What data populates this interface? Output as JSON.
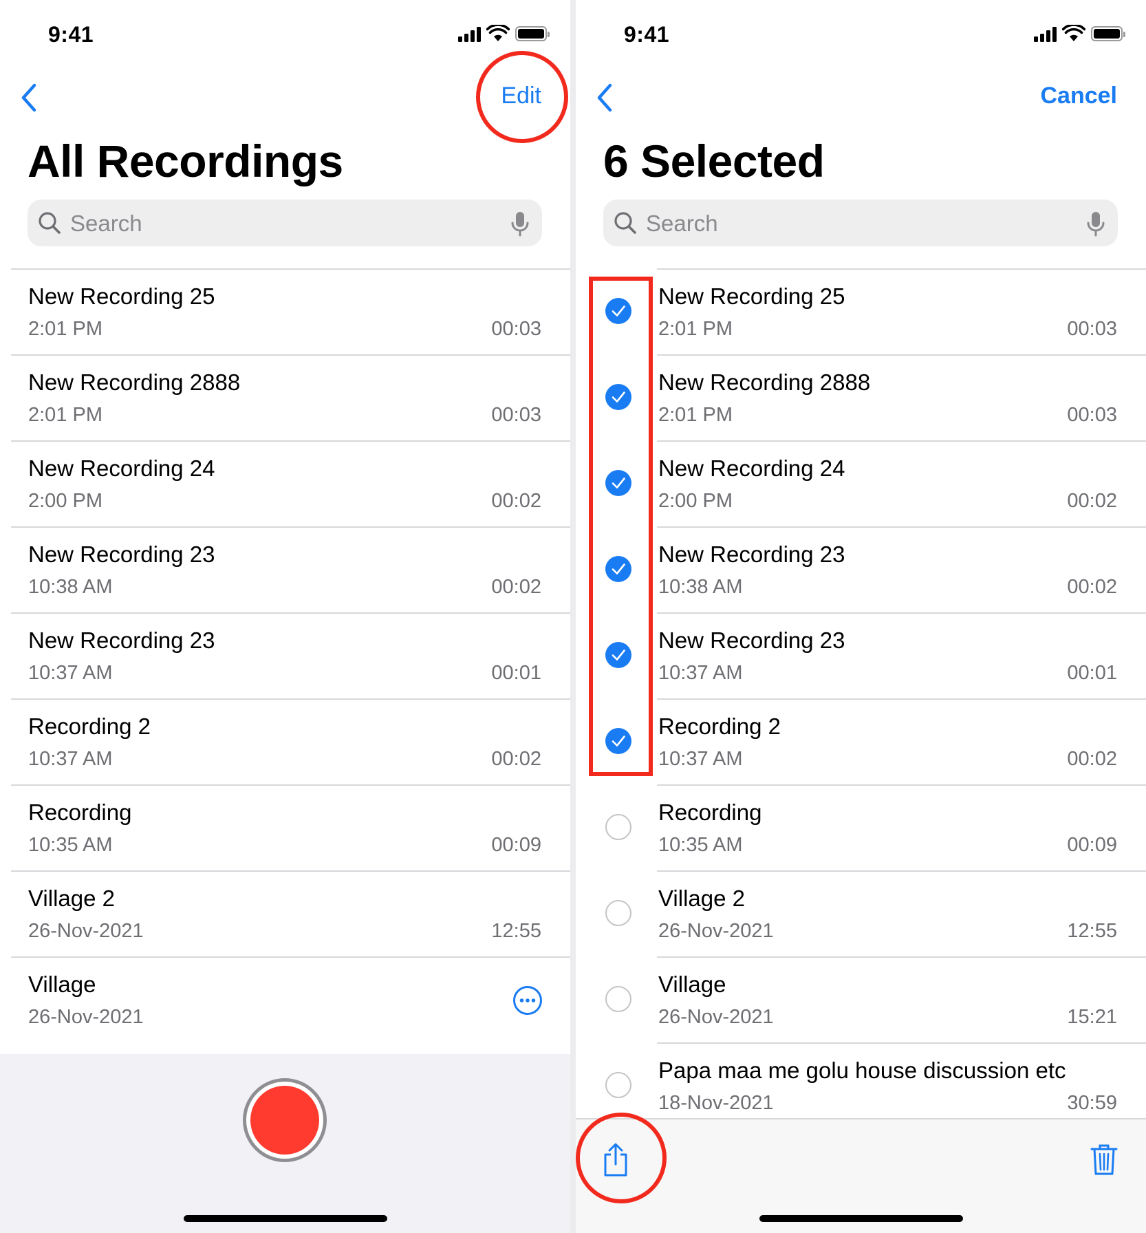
{
  "colors": {
    "accent": "#1a7cf2",
    "record": "#ff3b30",
    "annotation": "#f22a1d",
    "secondary_text": "#6e6e73"
  },
  "left": {
    "status": {
      "time": "9:41"
    },
    "nav": {
      "back_icon": "chevron-left-icon",
      "action_label": "Edit"
    },
    "title": "All Recordings",
    "search": {
      "placeholder": "Search"
    },
    "recordings": [
      {
        "title": "New Recording 25",
        "date": "2:01 PM",
        "duration": "00:03"
      },
      {
        "title": "New Recording 2888",
        "date": "2:01 PM",
        "duration": "00:03"
      },
      {
        "title": "New Recording 24",
        "date": "2:00 PM",
        "duration": "00:02"
      },
      {
        "title": "New Recording 23",
        "date": "10:38 AM",
        "duration": "00:02"
      },
      {
        "title": "New Recording 23",
        "date": "10:37 AM",
        "duration": "00:01"
      },
      {
        "title": "Recording 2",
        "date": "10:37 AM",
        "duration": "00:02"
      },
      {
        "title": "Recording",
        "date": "10:35 AM",
        "duration": "00:09"
      },
      {
        "title": "Village 2",
        "date": "26-Nov-2021",
        "duration": "12:55"
      },
      {
        "title": "Village",
        "date": "26-Nov-2021",
        "duration": "",
        "icon": "more-icon"
      }
    ]
  },
  "right": {
    "status": {
      "time": "9:41"
    },
    "nav": {
      "back_icon": "chevron-left-icon",
      "action_label": "Cancel"
    },
    "title": "6 Selected",
    "search": {
      "placeholder": "Search"
    },
    "recordings": [
      {
        "title": "New Recording 25",
        "date": "2:01 PM",
        "duration": "00:03",
        "selected": true
      },
      {
        "title": "New Recording 2888",
        "date": "2:01 PM",
        "duration": "00:03",
        "selected": true
      },
      {
        "title": "New Recording 24",
        "date": "2:00 PM",
        "duration": "00:02",
        "selected": true
      },
      {
        "title": "New Recording 23",
        "date": "10:38 AM",
        "duration": "00:02",
        "selected": true
      },
      {
        "title": "New Recording 23",
        "date": "10:37 AM",
        "duration": "00:01",
        "selected": true
      },
      {
        "title": "Recording 2",
        "date": "10:37 AM",
        "duration": "00:02",
        "selected": true
      },
      {
        "title": "Recording",
        "date": "10:35 AM",
        "duration": "00:09",
        "selected": false
      },
      {
        "title": "Village 2",
        "date": "26-Nov-2021",
        "duration": "12:55",
        "selected": false
      },
      {
        "title": "Village",
        "date": "26-Nov-2021",
        "duration": "15:21",
        "selected": false
      },
      {
        "title": "Papa maa me golu house discussion etc",
        "date": "18-Nov-2021",
        "duration": "30:59",
        "selected": false
      }
    ],
    "toolbar": {
      "share_icon": "share-icon",
      "delete_icon": "trash-icon"
    }
  }
}
